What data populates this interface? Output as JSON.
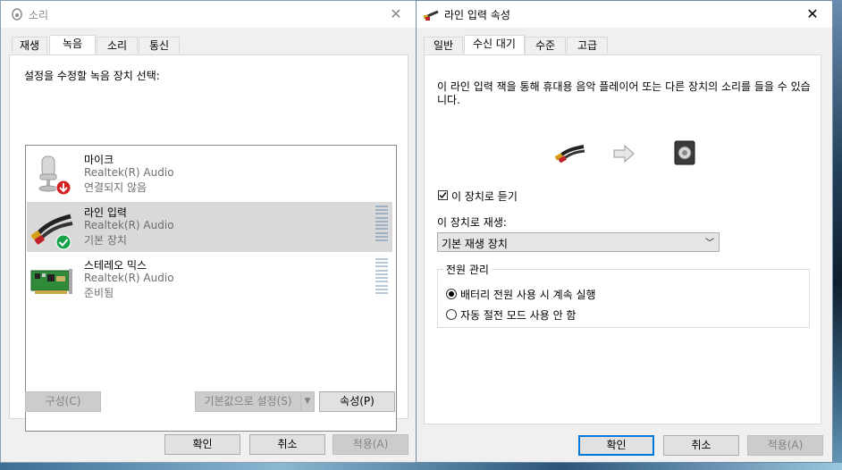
{
  "window_sound": {
    "title": "소리",
    "tabs": [
      {
        "label": "재생"
      },
      {
        "label": "녹음"
      },
      {
        "label": "소리"
      },
      {
        "label": "통신"
      }
    ],
    "instruction": "설정을 수정할 녹음 장치 선택:",
    "devices": [
      {
        "name": "마이크",
        "driver": "Realtek(R) Audio",
        "status": "연결되지 않음",
        "icon": "microphone-icon",
        "badge": "red-down-arrow"
      },
      {
        "name": "라인 입력",
        "driver": "Realtek(R) Audio",
        "status": "기본 장치",
        "icon": "rca-cable-icon",
        "badge": "green-check",
        "selected": true
      },
      {
        "name": "스테레오 믹스",
        "driver": "Realtek(R) Audio",
        "status": "준비됨",
        "icon": "sound-card-icon"
      }
    ],
    "buttons": {
      "configure": "구성(C)",
      "set_default": "기본값으로 설정(S)",
      "properties": "속성(P)",
      "ok": "확인",
      "cancel": "취소",
      "apply": "적용(A)"
    }
  },
  "window_props": {
    "title": "라인 입력 속성",
    "tabs": [
      {
        "label": "일반"
      },
      {
        "label": "수신 대기"
      },
      {
        "label": "수준"
      },
      {
        "label": "고급"
      }
    ],
    "description": "이 라인 입력 잭을 통해 휴대용 음악 플레이어 또는 다른 장치의 소리를 들을 수 있습니다.",
    "listen_checkbox": {
      "label": "이 장치로 듣기",
      "checked": true
    },
    "playback_label": "이 장치로 재생:",
    "playback_select": "기본 재생 장치",
    "power": {
      "legend": "전원 관리",
      "options": [
        {
          "label": "배터리 전원 사용 시 계속 실행",
          "selected": true
        },
        {
          "label": "자동 절전 모드 사용 안 함",
          "selected": false
        }
      ]
    },
    "buttons": {
      "ok": "확인",
      "cancel": "취소",
      "apply": "적용(A)"
    }
  },
  "colors": {
    "accent": "#0078d7",
    "selected_row": "#d9d9d9",
    "disabled_text": "#838383"
  }
}
